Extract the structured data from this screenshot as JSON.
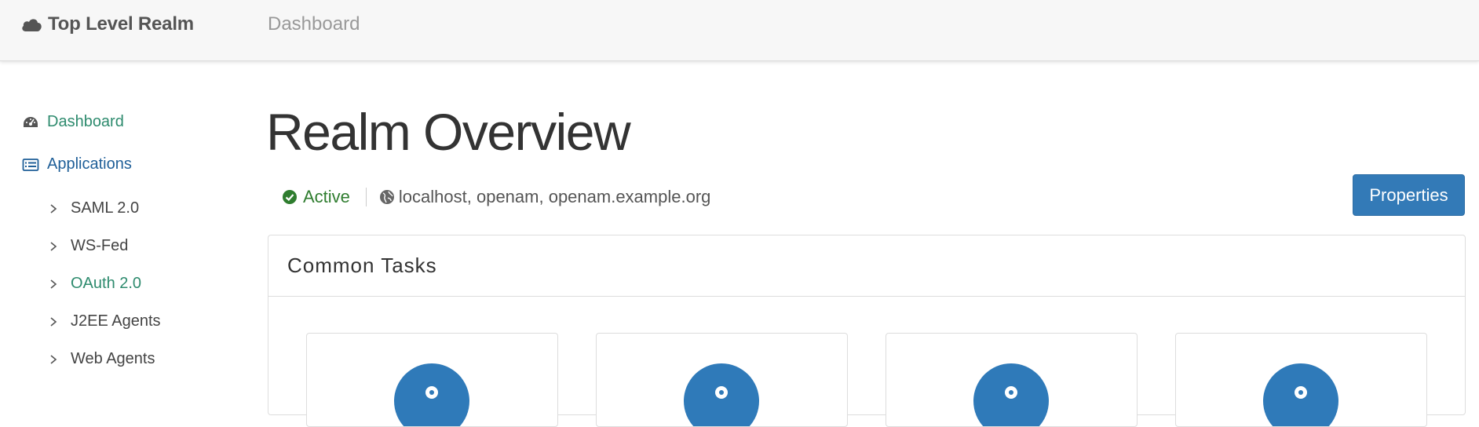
{
  "navbar": {
    "brand": "Top Level Realm",
    "brand_icon": "cloud-icon",
    "link": "Dashboard"
  },
  "sidebar": {
    "items": [
      {
        "label": "Dashboard",
        "icon": "dashboard-icon",
        "color": "#2e8b6e"
      },
      {
        "label": "Applications",
        "icon": "list-icon",
        "color": "#1f5f98"
      }
    ],
    "subitems": [
      {
        "label": "SAML 2.0",
        "active": false
      },
      {
        "label": "WS-Fed",
        "active": false
      },
      {
        "label": "OAuth 2.0",
        "active": true
      },
      {
        "label": "J2EE Agents",
        "active": false
      },
      {
        "label": "Web Agents",
        "active": false
      }
    ]
  },
  "main": {
    "title": "Realm Overview",
    "status": "Active",
    "status_icon": "check-circle-icon",
    "hosts": "localhost, openam, openam.example.org",
    "hosts_icon": "globe-icon",
    "properties_button": "Properties",
    "panel_title": "Common Tasks"
  },
  "colors": {
    "accent": "#337ab7",
    "active_green": "#2f7d2f",
    "task_icon_bg": "#2f7ab9"
  }
}
